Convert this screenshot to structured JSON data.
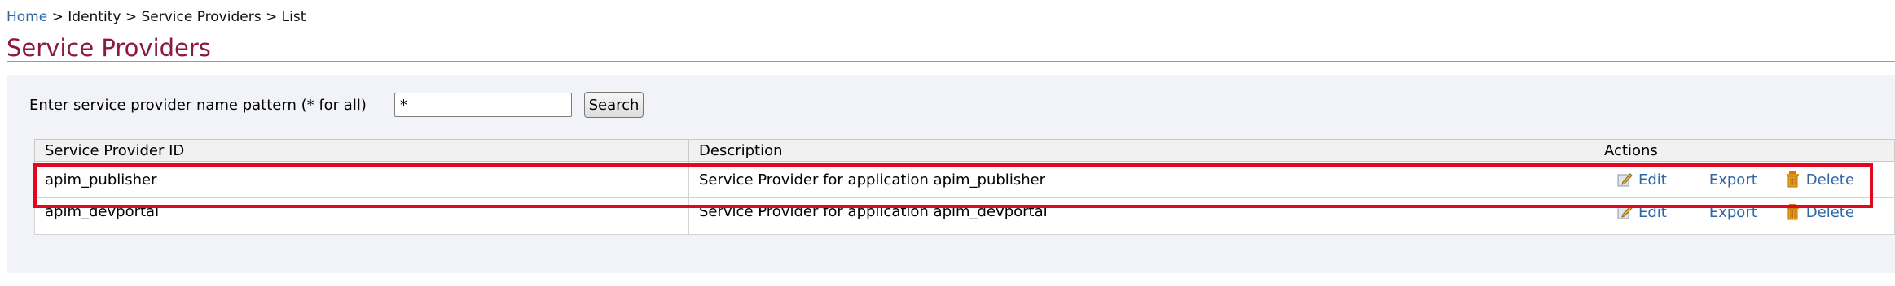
{
  "breadcrumb": {
    "home": "Home",
    "separator": ">",
    "items": [
      "Identity",
      "Service Providers",
      "List"
    ]
  },
  "page_title": "Service Providers",
  "search": {
    "label": "Enter service provider name pattern (* for all)",
    "value": "*",
    "button_label": "Search"
  },
  "table": {
    "headers": [
      "Service Provider ID",
      "Description",
      "Actions"
    ],
    "rows": [
      {
        "id": "apim_publisher",
        "description": "Service Provider for application apim_publisher"
      },
      {
        "id": "apim_devportal",
        "description": "Service Provider for application apim_devportal"
      }
    ],
    "actions": {
      "edit": "Edit",
      "export": "Export",
      "delete": "Delete"
    }
  },
  "icons": {
    "edit": "edit-pencil-icon",
    "delete": "trash-icon"
  },
  "colors": {
    "link": "#2f66a6",
    "title": "#8c1a3b",
    "highlight": "#e3061f"
  }
}
